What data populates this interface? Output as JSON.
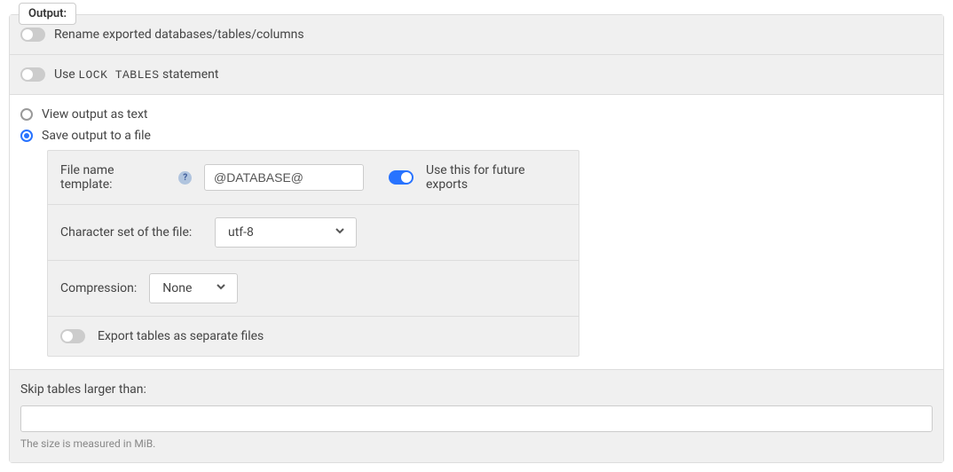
{
  "legend": "Output:",
  "rename_row": {
    "label": "Rename exported databases/tables/columns",
    "enabled": false
  },
  "lock_row": {
    "prefix": "Use ",
    "code": "LOCK TABLES",
    "suffix": " statement",
    "enabled": false
  },
  "output_mode": {
    "view_as_text_label": "View output as text",
    "save_to_file_label": "Save output to a file",
    "selected": "save"
  },
  "file_settings": {
    "template_label": "File name template:",
    "template_value": "@DATABASE@",
    "future_label": "Use this for future exports",
    "future_enabled": true,
    "charset_label": "Character set of the file:",
    "charset_value": "utf-8",
    "compression_label": "Compression:",
    "compression_value": "None",
    "separate_files_label": "Export tables as separate files",
    "separate_files_enabled": false
  },
  "skip": {
    "label": "Skip tables larger than:",
    "value": "",
    "hint": "The size is measured in MiB."
  }
}
